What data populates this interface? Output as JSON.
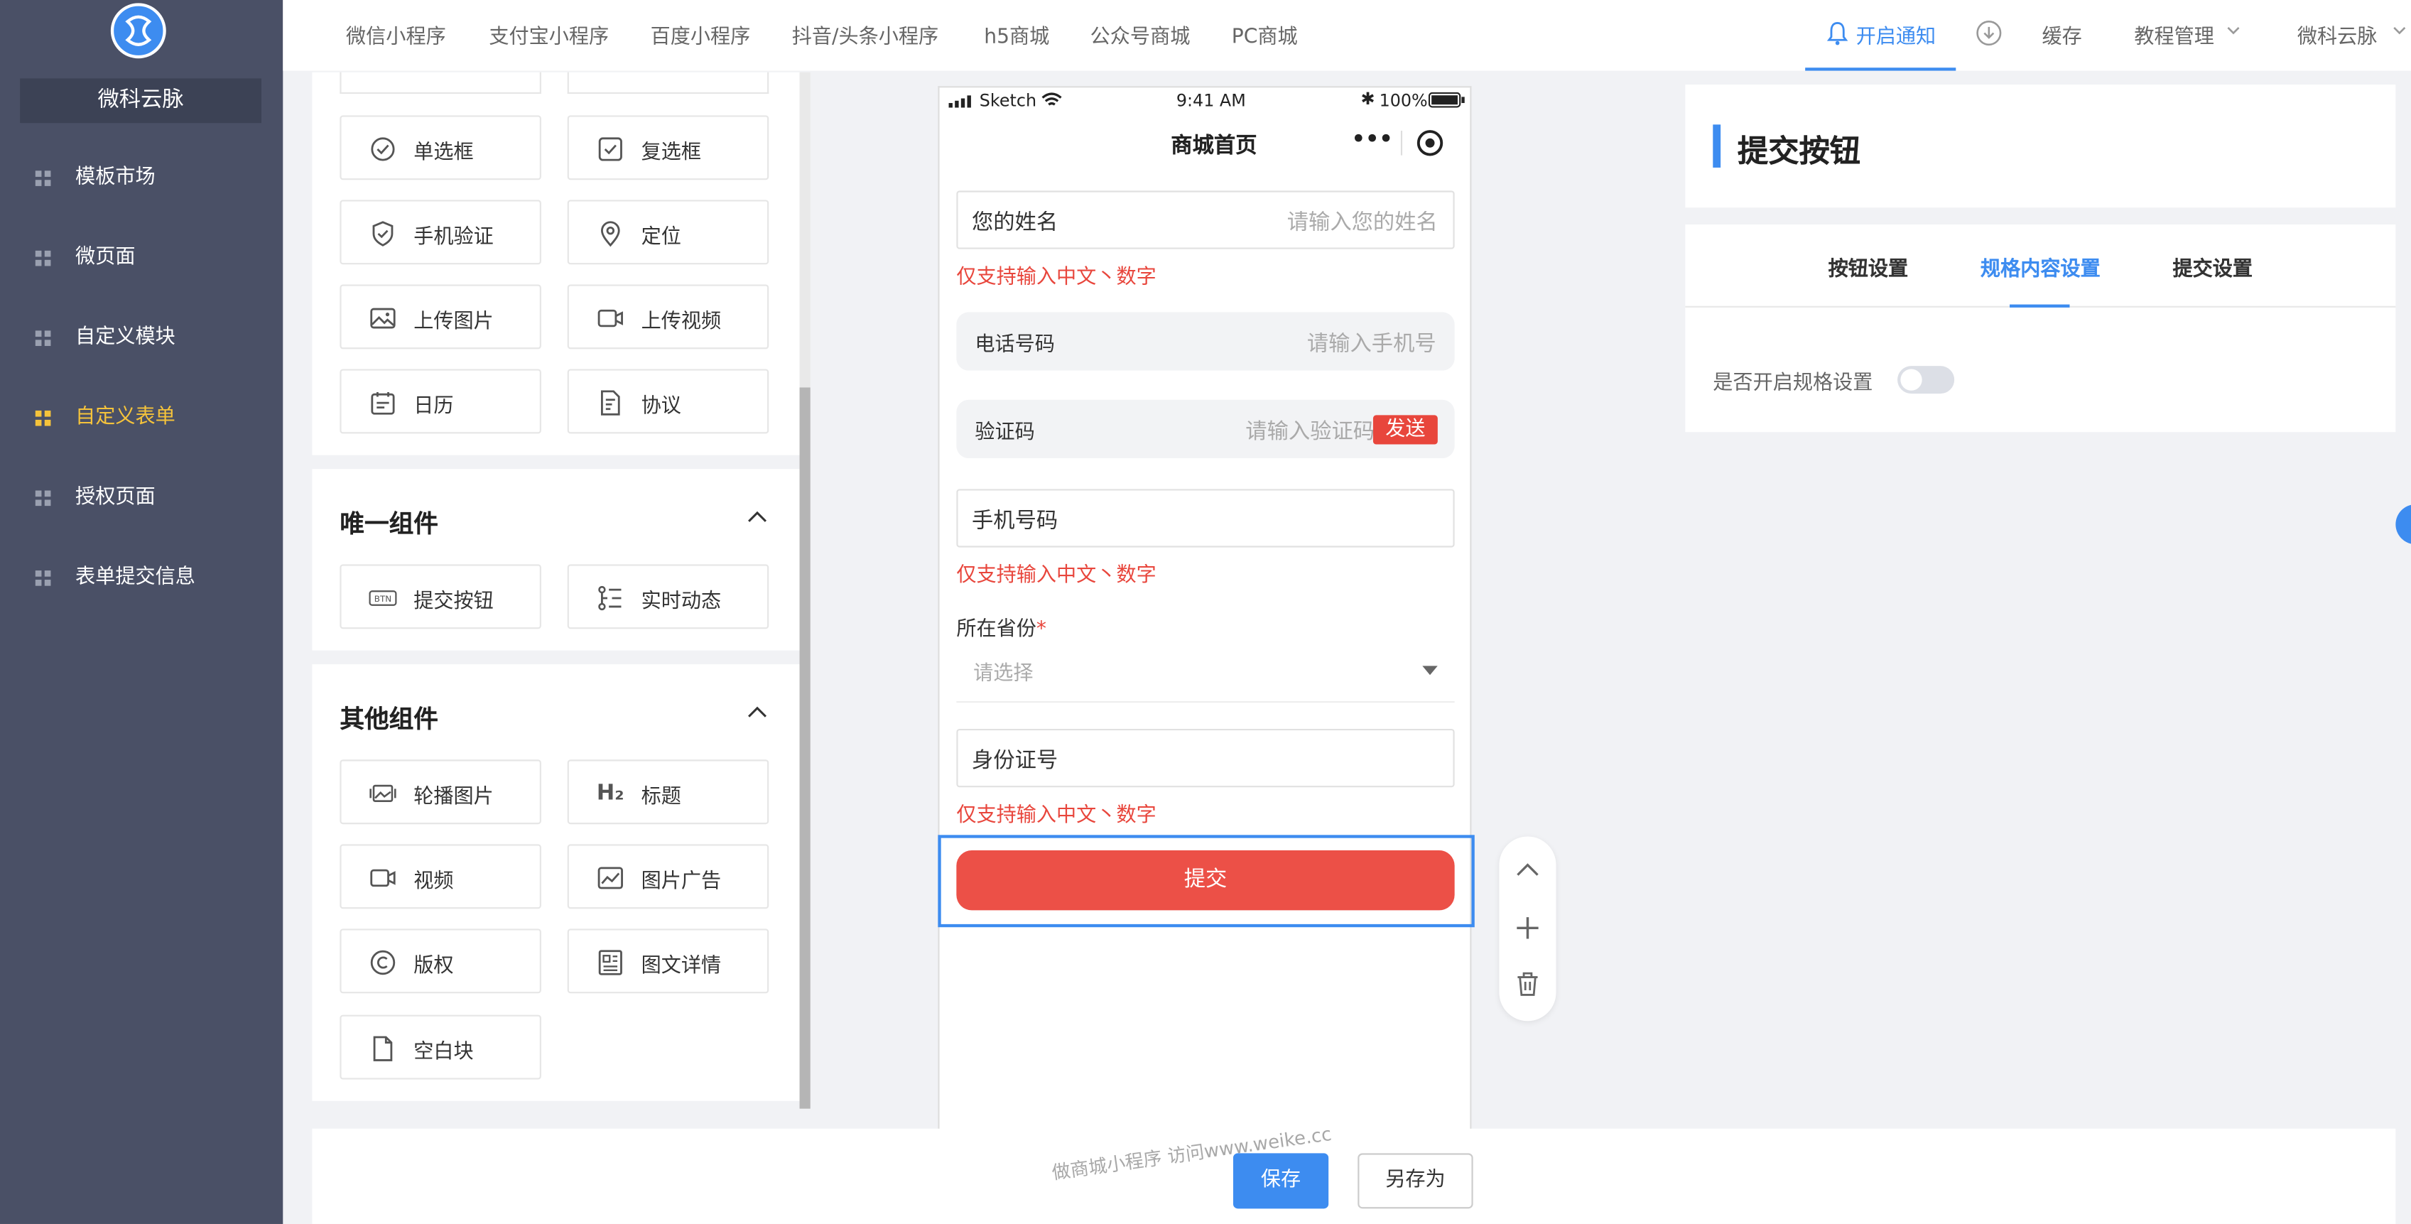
{
  "sidebar": {
    "brand": "微科云脉",
    "items": [
      {
        "label": "模板市场"
      },
      {
        "label": "微页面"
      },
      {
        "label": "自定义模块"
      },
      {
        "label": "自定义表单"
      },
      {
        "label": "授权页面"
      },
      {
        "label": "表单提交信息"
      }
    ]
  },
  "topbar": {
    "nav": [
      "微信小程序",
      "支付宝小程序",
      "百度小程序",
      "抖音/头条小程序",
      "h5商城",
      "公众号商城",
      "PC商城"
    ],
    "notify": "开启通知",
    "cache": "缓存",
    "tutorial": "教程管理",
    "user": "微科云脉"
  },
  "components": {
    "basic": [
      {
        "label": "单选框",
        "icon": "radio-icon"
      },
      {
        "label": "复选框",
        "icon": "checkbox-icon"
      },
      {
        "label": "手机验证",
        "icon": "shield-icon"
      },
      {
        "label": "定位",
        "icon": "location-icon"
      },
      {
        "label": "上传图片",
        "icon": "image-icon"
      },
      {
        "label": "上传视频",
        "icon": "video-icon"
      },
      {
        "label": "日历",
        "icon": "calendar-icon"
      },
      {
        "label": "协议",
        "icon": "document-icon"
      }
    ],
    "unique_title": "唯一组件",
    "unique": [
      {
        "label": "提交按钮",
        "icon": "btn-icon"
      },
      {
        "label": "实时动态",
        "icon": "list-icon"
      }
    ],
    "other_title": "其他组件",
    "other": [
      {
        "label": "轮播图片",
        "icon": "carousel-icon"
      },
      {
        "label": "标题",
        "icon": "h2-icon",
        "glyph": "H₂"
      },
      {
        "label": "视频",
        "icon": "video-icon"
      },
      {
        "label": "图片广告",
        "icon": "picture-icon"
      },
      {
        "label": "版权",
        "icon": "copyright-icon",
        "glyph": "©"
      },
      {
        "label": "图文详情",
        "icon": "article-icon"
      },
      {
        "label": "空白块",
        "icon": "blank-icon"
      }
    ]
  },
  "phone": {
    "carrier": "Sketch",
    "time": "9:41 AM",
    "battery": "100%",
    "page_title": "商城首页",
    "fields": {
      "name": {
        "label": "您的姓名",
        "placeholder": "请输入您的姓名"
      },
      "name_error": "仅支持输入中文丶数字",
      "phone": {
        "label": "电话号码",
        "placeholder": "请输入手机号"
      },
      "code": {
        "label": "验证码",
        "placeholder": "请输入验证码",
        "send": "发送"
      },
      "mobile": {
        "label": "手机号码"
      },
      "mobile_error": "仅支持输入中文丶数字",
      "province": {
        "label": "所在省份",
        "required": "*",
        "placeholder": "请选择"
      },
      "idcard": {
        "label": "身份证号"
      },
      "idcard_error": "仅支持输入中文丶数字"
    },
    "submit": "提交"
  },
  "right_panel": {
    "title": "提交按钮",
    "tabs": [
      "按钮设置",
      "规格内容设置",
      "提交设置"
    ],
    "active_tab": 1,
    "setting_label": "是否开启规格设置",
    "setting_enabled": false
  },
  "bottom": {
    "save": "保存",
    "save_as": "另存为",
    "watermark": "做商城小程序 访问www.weike.cc"
  },
  "colors": {
    "sidebar_bg": "#4a5066",
    "accent": "#3d8cf0",
    "active_nav": "#f5c33b",
    "error": "#e8463c",
    "submit_bg": "#ec5047"
  }
}
